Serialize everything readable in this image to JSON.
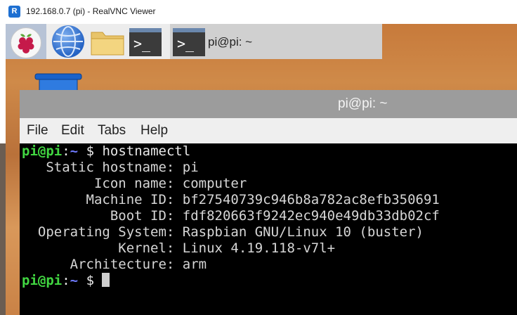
{
  "vnc": {
    "title": "192.168.0.7 (pi) - RealVNC Viewer",
    "icon": "realvnc-icon"
  },
  "taskbar": {
    "task_label": "pi@pi: ~",
    "terminal_glyph": ">_"
  },
  "terminal": {
    "title": "pi@pi: ~",
    "menu": [
      "File",
      "Edit",
      "Tabs",
      "Help"
    ],
    "prompt_user": "pi@pi",
    "prompt_sep": ":",
    "prompt_dir": "~",
    "prompt_sym": "$",
    "command": "hostnamectl",
    "output": [
      "   Static hostname: pi",
      "         Icon name: computer",
      "        Machine ID: bf27540739c946b8a782ac8efb350691",
      "           Boot ID: fdf820663f9242ec940e49db33db02cf",
      "  Operating System: Raspbian GNU/Linux 10 (buster)",
      "            Kernel: Linux 4.19.118-v7l+",
      "      Architecture: arm"
    ]
  },
  "colors": {
    "prompt_user": "#41d641",
    "prompt_dir": "#6f7bff",
    "terminal_bg": "#000000",
    "title_bar": "#9c9c9c"
  }
}
